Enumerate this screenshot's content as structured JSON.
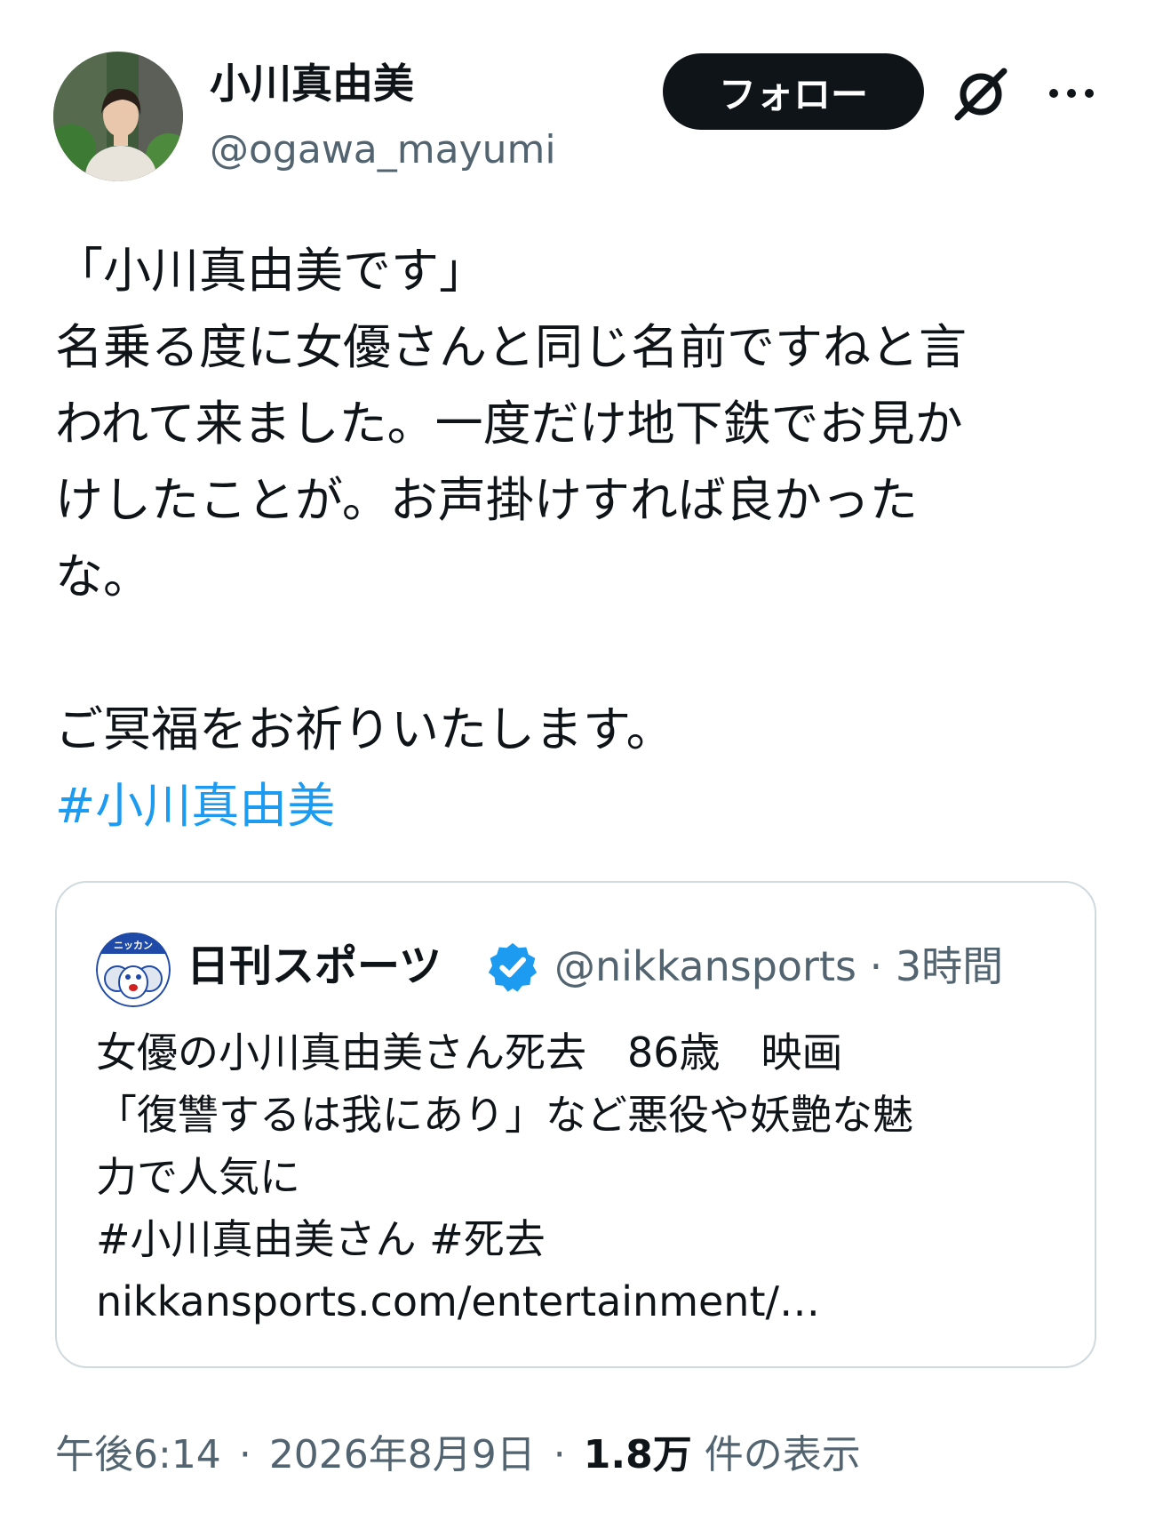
{
  "author": {
    "display_name": "小川真由美",
    "handle": "@ogawa_mayumi",
    "avatar_icon": "user-avatar-photo"
  },
  "header": {
    "follow_label": "フォロー",
    "grok_icon": "grok-icon",
    "more_icon": "more-dots-icon"
  },
  "tweet": {
    "lines": [
      "「小川真由美です」",
      "名乗る度に女優さんと同じ名前ですねと言",
      "われて来ました。一度だけ地下鉄でお見か",
      "けしたことが。お声掛けすれば良かった",
      "な。",
      "ご冥福をお祈りいたします。"
    ],
    "hashtag": "#小川真由美"
  },
  "quote": {
    "display_name": "日刊スポーツ",
    "handle": "@nikkansports",
    "separator": "·",
    "time": "3時間",
    "verified_icon": "verified-badge-icon",
    "avatar_icon": "nikkan-logo",
    "avatar_text": "ニッカン",
    "lines": [
      "女優の小川真由美さん死去　86歳　映画",
      "「復讐するは我にあり」など悪役や妖艶な魅",
      "力で人気に",
      "#小川真由美さん #死去",
      "nikkansports.com/entertainment/…"
    ]
  },
  "meta": {
    "time": "午後6:14",
    "separator": "·",
    "date": "2026年8月9日",
    "views_count": "1.8万",
    "views_label": "件の表示"
  },
  "colors": {
    "text": "#0f1419",
    "secondary": "#536471",
    "link": "#1d9bf0",
    "border": "#cfd9de",
    "button_bg": "#0f1419"
  }
}
